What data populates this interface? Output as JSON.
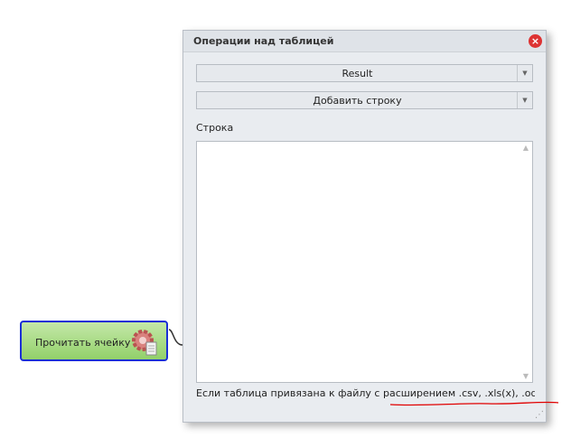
{
  "node": {
    "label": "Прочитать ячейку",
    "icon": "gear-document-icon"
  },
  "dialog": {
    "title": "Операции над таблицей",
    "table_select": {
      "value": "Result"
    },
    "operation_select": {
      "value": "Добавить строку"
    },
    "row_label": "Строка",
    "row_value": "",
    "footer_text": "Если таблица привязана к файлу с расширением .csv, .xls(x), .ods, то в ка"
  },
  "colors": {
    "node_border": "#1b2fd6",
    "node_fill": "#a6da82",
    "annotation": "#e00000"
  }
}
